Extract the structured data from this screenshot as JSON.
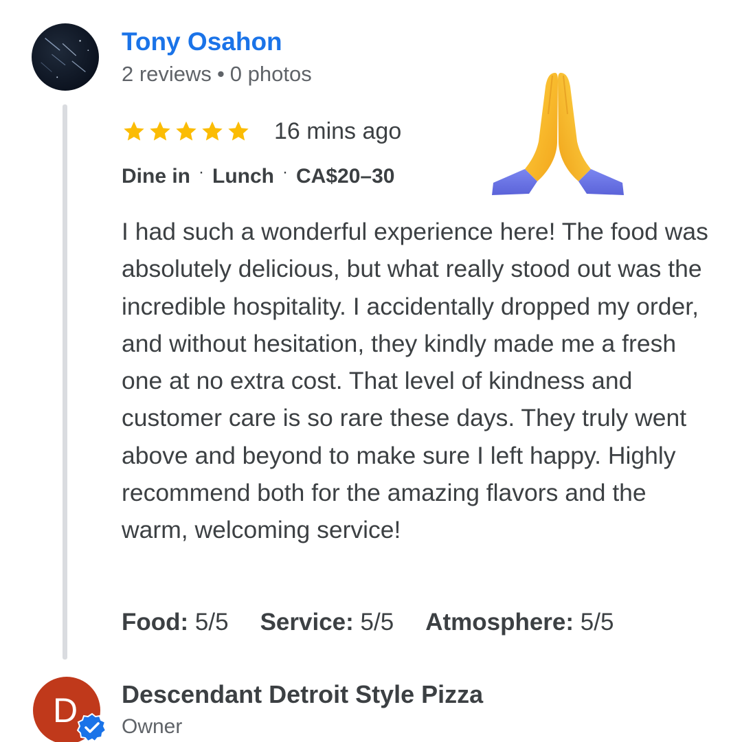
{
  "review": {
    "reviewer": {
      "name": "Tony Osahon",
      "reviews_count": "2 reviews",
      "separator": "•",
      "photos_count": "0 photos",
      "avatar_icon": "night-sky-avatar"
    },
    "rating": {
      "stars": 5,
      "max_stars": 5,
      "star_color": "#fbbc04",
      "time_ago": "16 mins ago"
    },
    "tags": [
      "Dine in",
      "Lunch",
      "CA$20–30"
    ],
    "tag_separator": "·",
    "emoji": "praying-hands-icon",
    "text": "I had such a wonderful experience here! The food was absolutely delicious, but what really stood out was the incredible hospitality. I accidentally dropped my order, and without hesitation, they kindly made me a fresh one at no extra cost. That level of kindness and customer care is so rare these days. They truly went above and beyond to make sure I left happy. Highly recommend both for the amazing flavors and the warm, welcoming service!",
    "sub_ratings": [
      {
        "label": "Food:",
        "value": "5/5"
      },
      {
        "label": "Service:",
        "value": "5/5"
      },
      {
        "label": "Atmosphere:",
        "value": "5/5"
      }
    ]
  },
  "owner_reply": {
    "avatar_initial": "D",
    "avatar_color": "#c0391b",
    "verified_icon": "verified-check-icon",
    "verified_color": "#1a73e8",
    "name": "Descendant Detroit Style Pizza",
    "role": "Owner"
  },
  "colors": {
    "link_blue": "#1a73e8",
    "text": "#3c4043",
    "secondary_text": "#5f6368",
    "thread_line": "#dadce0"
  }
}
